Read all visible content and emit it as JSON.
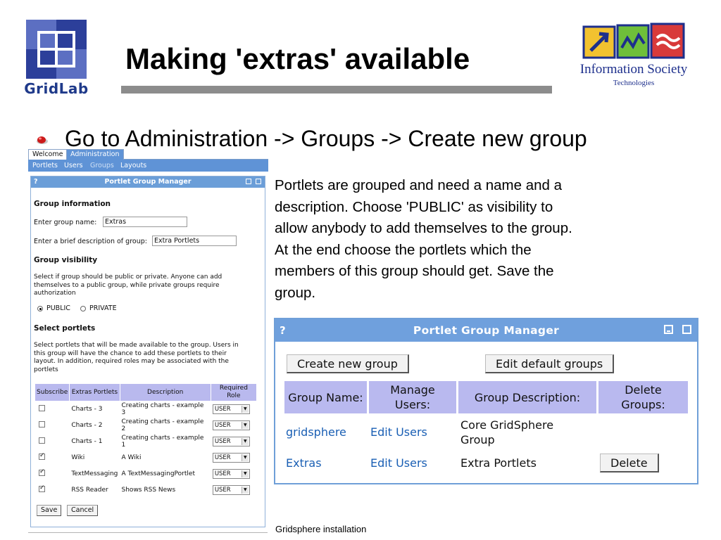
{
  "slide": {
    "title": "Making 'extras' available",
    "bullet": "Go to Administration -> Groups -> Create new group",
    "body_lines": [
      "Portlets are grouped and need a name and a",
      "description. Choose 'PUBLIC' as visibility to",
      "allow anybody to add themselves to the group.",
      "At the end choose the portlets which the",
      "members of this group should get. Save the",
      "group."
    ],
    "footer": "Gridsphere installation",
    "logo_left_text": "GridLab",
    "logo_right_text": "Information Society",
    "logo_right_sub": "Technologies",
    "colors": {
      "gridlab_blue": "#1f3a8a",
      "title_rule": "#8c8c8c",
      "panel_header": "#6fa0dd",
      "table_header": "#b9b9ef",
      "link": "#1a5fb4"
    }
  },
  "small_shot": {
    "tabs": [
      "Welcome",
      "Administration"
    ],
    "subnav": [
      "Portlets",
      "Users",
      "Groups",
      "Layouts"
    ],
    "panel_title": "Portlet Group Manager",
    "help": "?",
    "group_info_heading": "Group information",
    "name_label": "Enter group name:",
    "name_value": "Extras",
    "desc_label": "Enter a brief description of group:",
    "desc_value": "Extra Portlets",
    "visibility_heading": "Group visibility",
    "visibility_text": "Select if group should be public or private. Anyone can add themselves to a public group, while private groups require authorization",
    "public_label": "PUBLIC",
    "private_label": "PRIVATE",
    "select_heading": "Select portlets",
    "select_text": "Select portlets that will be made available to the group. Users in this group will have the chance to add these portlets to their layout. In addition, required roles may be associated with the portlets",
    "columns": [
      "Subscribe",
      "Extras Portlets",
      "Description",
      "Required Role"
    ],
    "rows": [
      {
        "checked": false,
        "name": "Charts - 3",
        "desc": "Creating charts - example 3",
        "role": "USER"
      },
      {
        "checked": false,
        "name": "Charts - 2",
        "desc": "Creating charts - example 2",
        "role": "USER"
      },
      {
        "checked": false,
        "name": "Charts - 1",
        "desc": "Creating charts - example 1",
        "role": "USER"
      },
      {
        "checked": true,
        "name": "Wiki",
        "desc": "A Wiki",
        "role": "USER"
      },
      {
        "checked": true,
        "name": "TextMessaging",
        "desc": "A TextMessagingPortlet",
        "role": "USER"
      },
      {
        "checked": true,
        "name": "RSS Reader",
        "desc": "Shows RSS News",
        "role": "USER"
      }
    ],
    "save_label": "Save",
    "cancel_label": "Cancel"
  },
  "big_shot": {
    "help": "?",
    "title": "Portlet Group Manager",
    "create_label": "Create new group",
    "edit_default_label": "Edit default groups",
    "columns": [
      "Group Name:",
      "Manage Users:",
      "Group Description:",
      "Delete Groups:"
    ],
    "rows": [
      {
        "name": "gridsphere",
        "manage": "Edit Users",
        "desc": "Core GridSphere Group",
        "delete": ""
      },
      {
        "name": "Extras",
        "manage": "Edit Users",
        "desc": "Extra Portlets",
        "delete": "Delete"
      }
    ]
  }
}
